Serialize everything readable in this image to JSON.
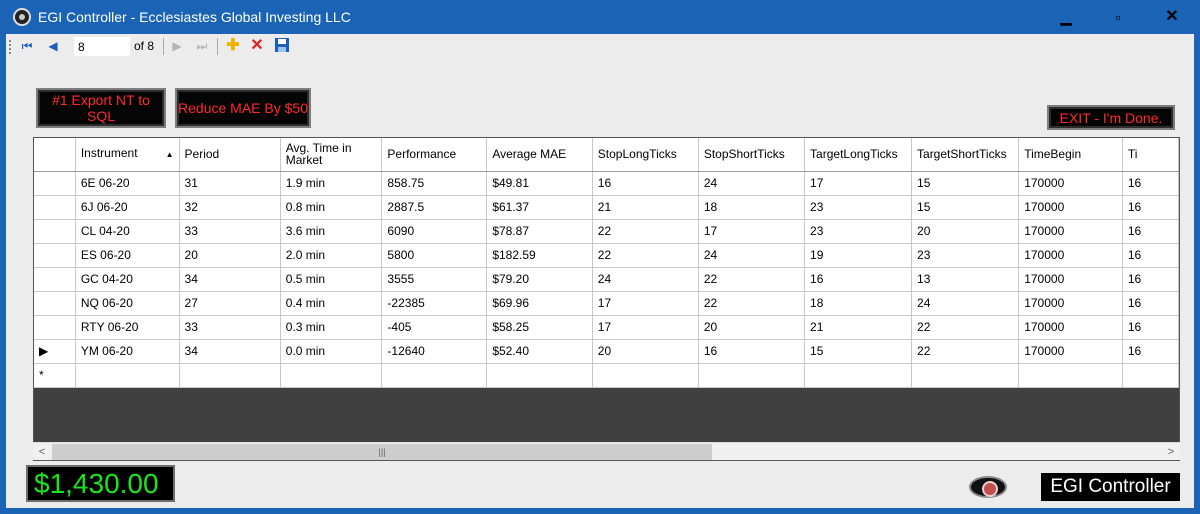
{
  "window": {
    "title": "EGI Controller - Ecclesiastes Global Investing LLC",
    "minimize_glyph": "▁",
    "maximize_glyph": "▫",
    "close_glyph": "✕"
  },
  "navigator": {
    "position": "8",
    "of_label": "of 8",
    "icons": [
      "first-record-icon",
      "previous-record-icon",
      "next-record-icon",
      "last-record-icon",
      "add-new-icon",
      "delete-icon",
      "save-icon"
    ]
  },
  "buttons": {
    "export_label": "#1 Export NT to SQL",
    "reduce_label": "Reduce MAE By $50",
    "exit_label": "EXIT - I'm Done."
  },
  "grid": {
    "columns": [
      "Instrument",
      "Period",
      "Avg. Time in Market",
      "Performance",
      "Average MAE",
      "StopLongTicks",
      "StopShortTicks",
      "TargetLongTicks",
      "TargetShortTicks",
      "TimeBegin",
      "Ti"
    ],
    "sorted_column": "Instrument",
    "rows": [
      {
        "instrument": "6E 06-20",
        "period": "31",
        "avg_time": "1.9 min",
        "performance": "858.75",
        "mae": "$49.81",
        "stop_long": "16",
        "stop_short": "24",
        "target_long": "17",
        "target_short": "15",
        "time_begin": "170000",
        "ti": "16"
      },
      {
        "instrument": "6J 06-20",
        "period": "32",
        "avg_time": "0.8 min",
        "performance": "2887.5",
        "mae": "$61.37",
        "stop_long": "21",
        "stop_short": "18",
        "target_long": "23",
        "target_short": "15",
        "time_begin": "170000",
        "ti": "16"
      },
      {
        "instrument": "CL 04-20",
        "period": "33",
        "avg_time": "3.6 min",
        "performance": "6090",
        "mae": "$78.87",
        "stop_long": "22",
        "stop_short": "17",
        "target_long": "23",
        "target_short": "20",
        "time_begin": "170000",
        "ti": "16"
      },
      {
        "instrument": "ES 06-20",
        "period": "20",
        "avg_time": "2.0 min",
        "performance": "5800",
        "mae": "$182.59",
        "stop_long": "22",
        "stop_short": "24",
        "target_long": "19",
        "target_short": "23",
        "time_begin": "170000",
        "ti": "16"
      },
      {
        "instrument": "GC 04-20",
        "period": "34",
        "avg_time": "0.5 min",
        "performance": "3555",
        "mae": "$79.20",
        "stop_long": "24",
        "stop_short": "22",
        "target_long": "16",
        "target_short": "13",
        "time_begin": "170000",
        "ti": "16"
      },
      {
        "instrument": "NQ 06-20",
        "period": "27",
        "avg_time": "0.4 min",
        "performance": "-22385",
        "mae": "$69.96",
        "stop_long": "17",
        "stop_short": "22",
        "target_long": "18",
        "target_short": "24",
        "time_begin": "170000",
        "ti": "16"
      },
      {
        "instrument": "RTY 06-20",
        "period": "33",
        "avg_time": "0.3 min",
        "performance": "-405",
        "mae": "$58.25",
        "stop_long": "17",
        "stop_short": "20",
        "target_long": "21",
        "target_short": "22",
        "time_begin": "170000",
        "ti": "16"
      },
      {
        "instrument": "YM 06-20",
        "period": "34",
        "avg_time": "0.0 min",
        "performance": "-12640",
        "mae": "$52.40",
        "stop_long": "20",
        "stop_short": "16",
        "target_long": "15",
        "target_short": "22",
        "time_begin": "170000",
        "ti": "16"
      }
    ],
    "current_row_indicator": "▶",
    "new_row_indicator": "*"
  },
  "footer": {
    "total_money": "$1,430.00",
    "brand_label": "EGI Controller"
  },
  "colors": {
    "titlebar": "#1b63b5",
    "selection": "#1c7fd6",
    "mae_text": "#1818d8",
    "stop_text": "#e01010",
    "target_text": "#108010",
    "money_text": "#19e619",
    "button_text": "#ff2a2a"
  }
}
